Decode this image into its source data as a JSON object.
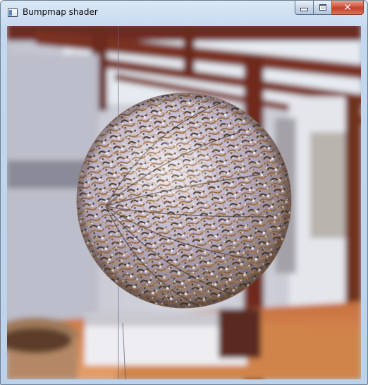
{
  "window": {
    "title": "Bumpmap shader",
    "buttons": {
      "minimize": "minimize-icon",
      "maximize": "maximize-icon",
      "close": "close-icon"
    }
  },
  "scene": {
    "description_icons": [
      "sphere",
      "pergola",
      "floor",
      "pot"
    ],
    "colors": {
      "wall": "#c9c9d3",
      "beam": "#6b2a1f",
      "floor": "#d98a52",
      "sky": "#e8eef4",
      "sphere_base": "#b9b2c8"
    }
  }
}
